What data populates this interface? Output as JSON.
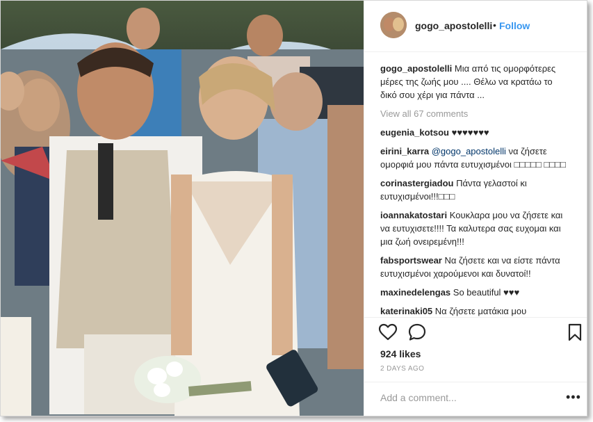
{
  "post": {
    "username": "gogo_apostolelli",
    "separator": "•",
    "follow_label": "Follow",
    "caption": "Μια από τις ομορφότερες μέρες της ζωής μου .... Θέλω να κρατάω το δικό σου χέρι για πάντα ...",
    "view_all_label": "View all 67 comments",
    "likes_label": "924 likes",
    "date_label": "2 DAYS AGO",
    "add_comment_placeholder": "Add a comment...",
    "more_label": "•••"
  },
  "comments": [
    {
      "user": "eugenia_kotsou",
      "text": "♥♥♥♥♥♥♥"
    },
    {
      "user": "eirini_karra",
      "mention": "@gogo_apostolelli",
      "text": "να ζήσετε ομορφιά μου πάντα ευτυχισμένοι □□□□□ □□□□"
    },
    {
      "user": "corinastergiadou",
      "text": "Πάντα γελαστοί κι ευτυχισμένοι!!!□□□"
    },
    {
      "user": "ioannakatostari",
      "text": "Κουκλαρα μου να ζήσετε και να ευτυχισετε!!!! Τα καλυτερα σας ευχομαι και μια ζωή ονειρεμένη!!!"
    },
    {
      "user": "fabsportswear",
      "text": "Να ζήσετε και να είστε πάντα ευτυχισμένοι χαρούμενοι και δυνατοί!!"
    },
    {
      "user": "maxinedelengas",
      "text": "So beautiful ♥♥♥"
    },
    {
      "user": "katerinaki05",
      "text": "Να ζήσετε ματάκια μου"
    }
  ],
  "icons": {
    "like": "heart-icon",
    "comment": "speech-bubble-icon",
    "save": "bookmark-icon"
  },
  "colors": {
    "follow": "#3897f0",
    "muted": "#999999",
    "text": "#262626",
    "border": "#efefef"
  }
}
